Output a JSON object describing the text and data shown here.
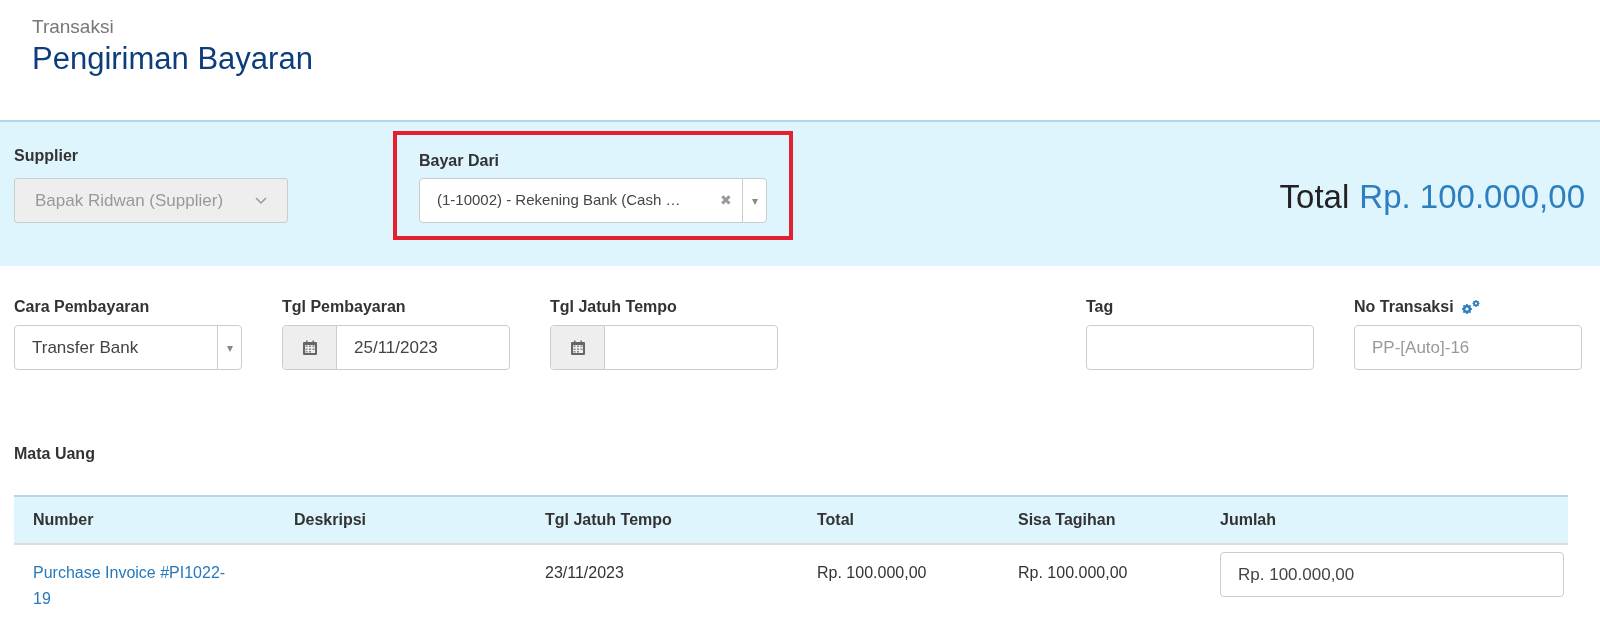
{
  "header": {
    "breadcrumb": "Transaksi",
    "title": "Pengiriman Bayaran"
  },
  "summary": {
    "supplier": {
      "label": "Supplier",
      "value": "Bapak Ridwan (Supplier)",
      "disabled": true
    },
    "pay_from": {
      "label": "Bayar Dari",
      "value": "(1-10002) - Rekening Bank (Cash …",
      "highlighted": true,
      "clear": "✖",
      "caret": "▾"
    },
    "total_label": "Total",
    "total_value": "Rp. 100.000,00"
  },
  "fields": [
    {
      "kind": "select",
      "label": "Cara Pembayaran",
      "value": "Transfer Bank",
      "caret": "▾"
    },
    {
      "kind": "date",
      "label": "Tgl Pembayaran",
      "value": "25/11/2023"
    },
    {
      "kind": "date",
      "label": "Tgl Jatuh Tempo"
    },
    {
      "kind": "text",
      "label": "Tag"
    },
    {
      "kind": "text",
      "label": "No Transaksi",
      "placeholder": "PP-[Auto]-16",
      "settings": true
    }
  ],
  "currency_label": "Mata Uang",
  "table": {
    "columns": [
      "Number",
      "Deskripsi",
      "Tgl Jatuh Tempo",
      "Total",
      "Sisa Tagihan",
      "Jumlah"
    ],
    "rows": [
      {
        "number": "Purchase Invoice #PI1022-19",
        "due": "23/11/2023",
        "total": "Rp. 100.000,00",
        "remaining": "Rp. 100.000,00",
        "amount": "Rp. 100.000,00"
      }
    ]
  }
}
